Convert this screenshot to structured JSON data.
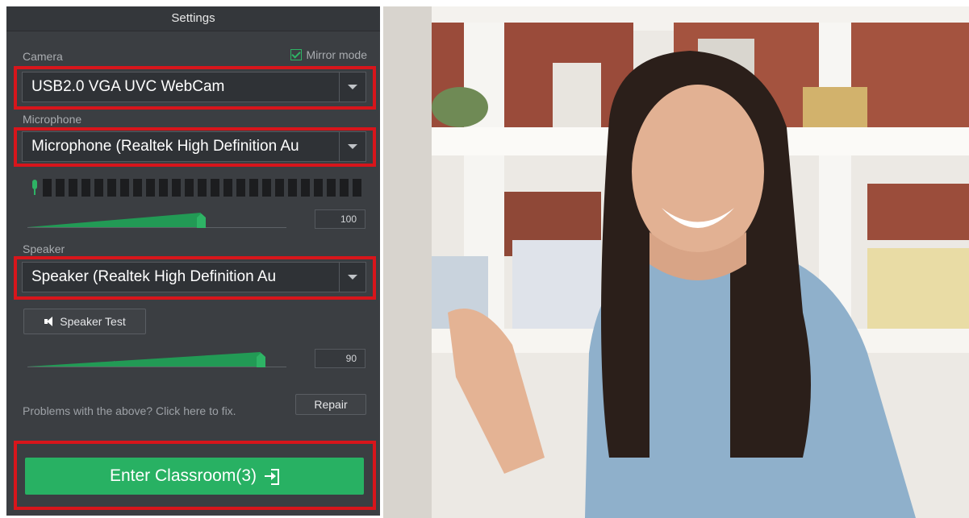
{
  "settings": {
    "title": "Settings",
    "camera_label": "Camera",
    "mirror_label": "Mirror mode",
    "mirror_checked": true,
    "camera_value": "USB2.0 VGA UVC WebCam",
    "microphone_label": "Microphone",
    "microphone_value": "Microphone (Realtek High Definition Au",
    "mic_volume": "100",
    "mic_volume_level": 0.67,
    "speaker_label": "Speaker",
    "speaker_value": "Speaker (Realtek High Definition Au",
    "speaker_test_label": "Speaker Test",
    "speaker_volume": "90",
    "speaker_volume_level": 0.9,
    "problems_text": "Problems with the above? Click here to fix.",
    "repair_label": "Repair",
    "enter_label": "Enter Classroom(3)"
  },
  "colors": {
    "panel_bg": "#3b3e42",
    "accent_green": "#28b163",
    "highlight_red": "#d8151b"
  },
  "icons": [
    "checkbox-icon",
    "dropdown-arrow-icon",
    "microphone-icon",
    "speaker-icon",
    "enter-icon"
  ]
}
